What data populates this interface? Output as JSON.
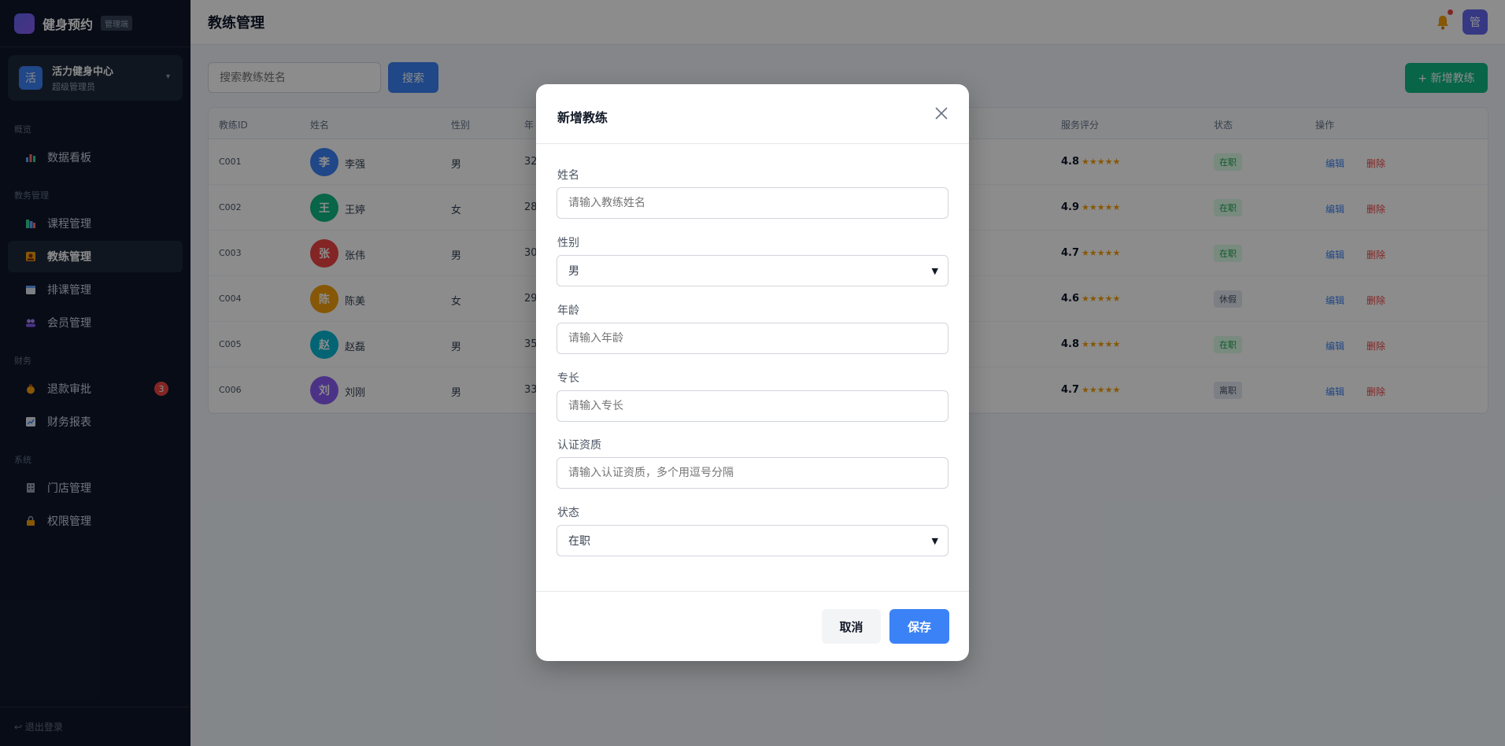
{
  "app": {
    "brand": "健身预约",
    "brand_tag": "管理端",
    "store_initial": "活",
    "store_name": "活力健身中心",
    "store_role": "超级管理员",
    "logout": "↩ 退出登录"
  },
  "nav": {
    "groups": [
      "概览",
      "教务管理",
      "财务",
      "系统"
    ],
    "items": [
      {
        "label": "数据看板",
        "icon": "chart-icon"
      },
      {
        "label": "课程管理",
        "icon": "books-icon"
      },
      {
        "label": "教练管理",
        "icon": "coach-icon"
      },
      {
        "label": "排课管理",
        "icon": "calendar-icon"
      },
      {
        "label": "会员管理",
        "icon": "members-icon"
      },
      {
        "label": "退款审批",
        "icon": "money-bag-icon",
        "badge": "3"
      },
      {
        "label": "财务报表",
        "icon": "trend-icon"
      },
      {
        "label": "门店管理",
        "icon": "building-icon"
      },
      {
        "label": "权限管理",
        "icon": "lock-icon"
      }
    ]
  },
  "header": {
    "title": "教练管理",
    "user_initial": "管"
  },
  "toolbar": {
    "search_placeholder": "搜索教练姓名",
    "search_label": "搜索",
    "add_label": "+ 新增教练"
  },
  "table": {
    "columns": [
      "教练ID",
      "姓名",
      "性别",
      "年",
      "服务评分",
      "状态",
      "操作"
    ],
    "rows": [
      {
        "id": "C001",
        "initial": "李",
        "name": "李强",
        "gender": "男",
        "age": "32",
        "rating": "4.8",
        "stars": "★★★★★",
        "status": "在职",
        "color": "#3b82f6"
      },
      {
        "id": "C002",
        "initial": "王",
        "name": "王婷",
        "gender": "女",
        "age": "28",
        "rating": "4.9",
        "stars": "★★★★★",
        "status": "在职",
        "color": "#10b981"
      },
      {
        "id": "C003",
        "initial": "张",
        "name": "张伟",
        "gender": "男",
        "age": "30",
        "rating": "4.7",
        "stars": "★★★★★",
        "status": "在职",
        "color": "#ef4444"
      },
      {
        "id": "C004",
        "initial": "陈",
        "name": "陈美",
        "gender": "女",
        "age": "29",
        "rating": "4.6",
        "stars": "★★★★★",
        "status": "休假",
        "color": "#f59e0b"
      },
      {
        "id": "C005",
        "initial": "赵",
        "name": "赵磊",
        "gender": "男",
        "age": "35",
        "rating": "4.8",
        "stars": "★★★★★",
        "status": "在职",
        "color": "#06b6d4"
      },
      {
        "id": "C006",
        "initial": "刘",
        "name": "刘刚",
        "gender": "男",
        "age": "33",
        "rating": "4.7",
        "stars": "★★★★★",
        "status": "离职",
        "color": "#8b5cf6"
      }
    ],
    "edit_label": "编辑",
    "delete_label": "删除"
  },
  "modal": {
    "title": "新增教练",
    "fields": {
      "name_label": "姓名",
      "name_placeholder": "请输入教练姓名",
      "gender_label": "性别",
      "gender_value": "男",
      "age_label": "年龄",
      "age_placeholder": "请输入年龄",
      "specialty_label": "专长",
      "specialty_placeholder": "请输入专长",
      "cert_label": "认证资质",
      "cert_placeholder": "请输入认证资质，多个用逗号分隔",
      "status_label": "状态",
      "status_value": "在职"
    },
    "cancel_label": "取消",
    "save_label": "保存"
  }
}
